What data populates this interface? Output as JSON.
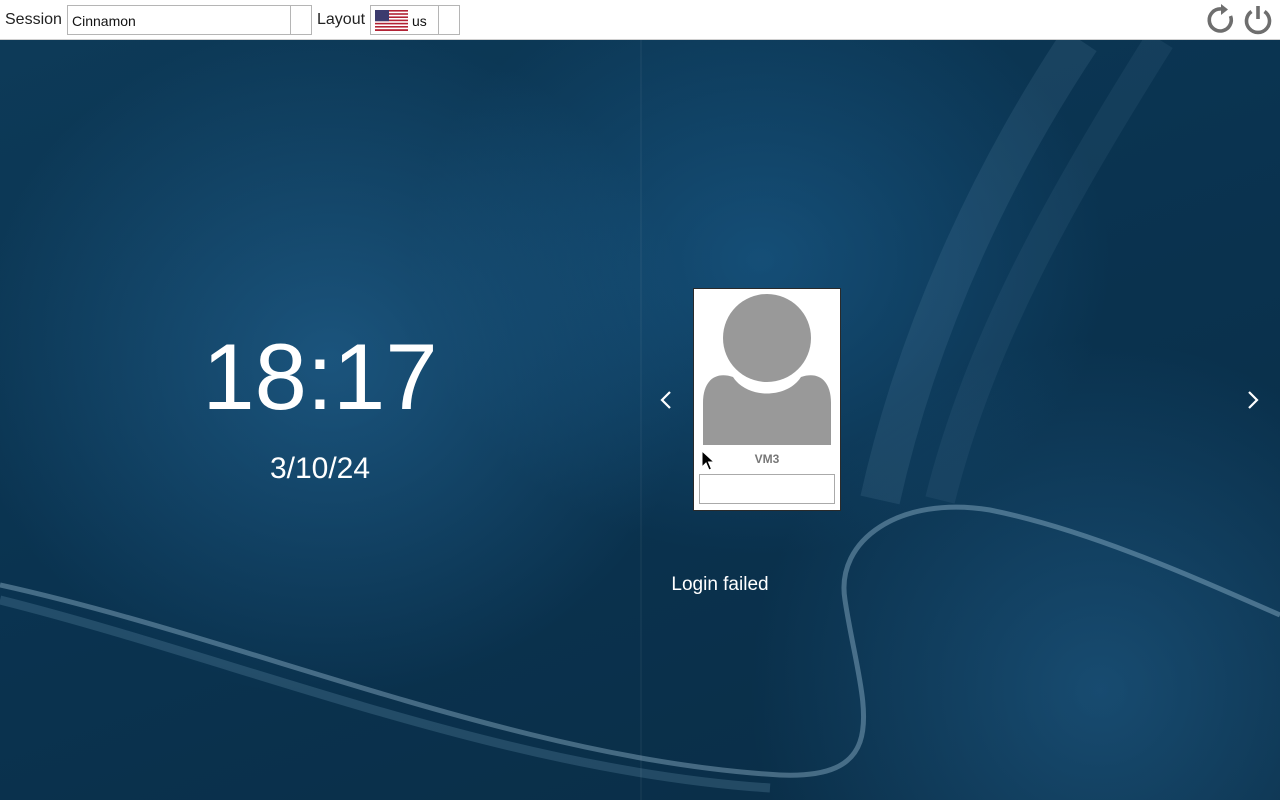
{
  "topbar": {
    "session_label": "Session",
    "session_value": "Cinnamon",
    "layout_label": "Layout",
    "layout_value": "us",
    "layout_flag_icon": "us-flag-icon",
    "restart_icon": "restart-icon",
    "power_icon": "power-icon"
  },
  "clock": {
    "time": "18:17",
    "date": "3/10/24"
  },
  "user_card": {
    "username": "VM3",
    "password_value": "",
    "avatar_icon": "user-avatar-icon"
  },
  "navigation": {
    "prev_icon": "chevron-left-icon",
    "next_icon": "chevron-right-icon"
  },
  "status": {
    "message": "Login failed"
  },
  "colors": {
    "background": "#0b2f48",
    "topbar": "#ffffff",
    "avatar": "#999999",
    "text": "#ffffff"
  }
}
